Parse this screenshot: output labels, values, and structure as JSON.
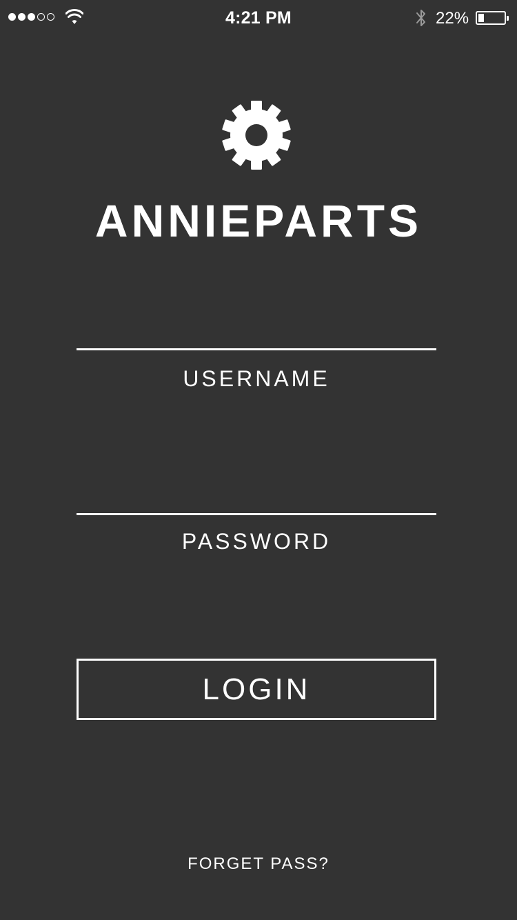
{
  "status_bar": {
    "signal_dots_filled": 3,
    "signal_dots_total": 5,
    "wifi_icon": "wifi-icon",
    "time": "4:21 PM",
    "bluetooth_icon": "bluetooth-icon",
    "battery_percent": "22%",
    "battery_level": 0.22
  },
  "brand": {
    "logo_icon": "gear-icon",
    "name": "ANNIEPARTS"
  },
  "form": {
    "username_label": "USERNAME",
    "password_label": "PASSWORD",
    "login_label": "LOGIN",
    "forget_label": "FORGET PASS?"
  },
  "colors": {
    "background": "#333333",
    "foreground": "#ffffff"
  }
}
